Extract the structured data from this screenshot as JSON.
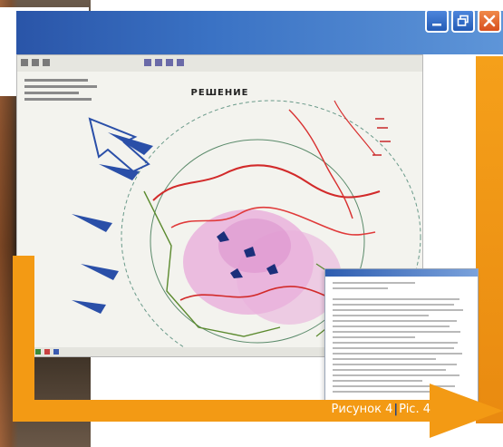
{
  "window": {
    "controls": {
      "minimize_icon": "minimize-icon",
      "restore_icon": "restore-icon",
      "close_icon": "close-icon"
    }
  },
  "map_screenshot": {
    "title": "РЕШЕНИЕ"
  },
  "caption": {
    "figure_ru": "Рисунок 4",
    "separator": "|",
    "figure_ua": "Pic. 4"
  },
  "colors": {
    "accent_orange": "#f39a14",
    "title_blue": "#2a55a8",
    "close_orange": "#e06428"
  }
}
